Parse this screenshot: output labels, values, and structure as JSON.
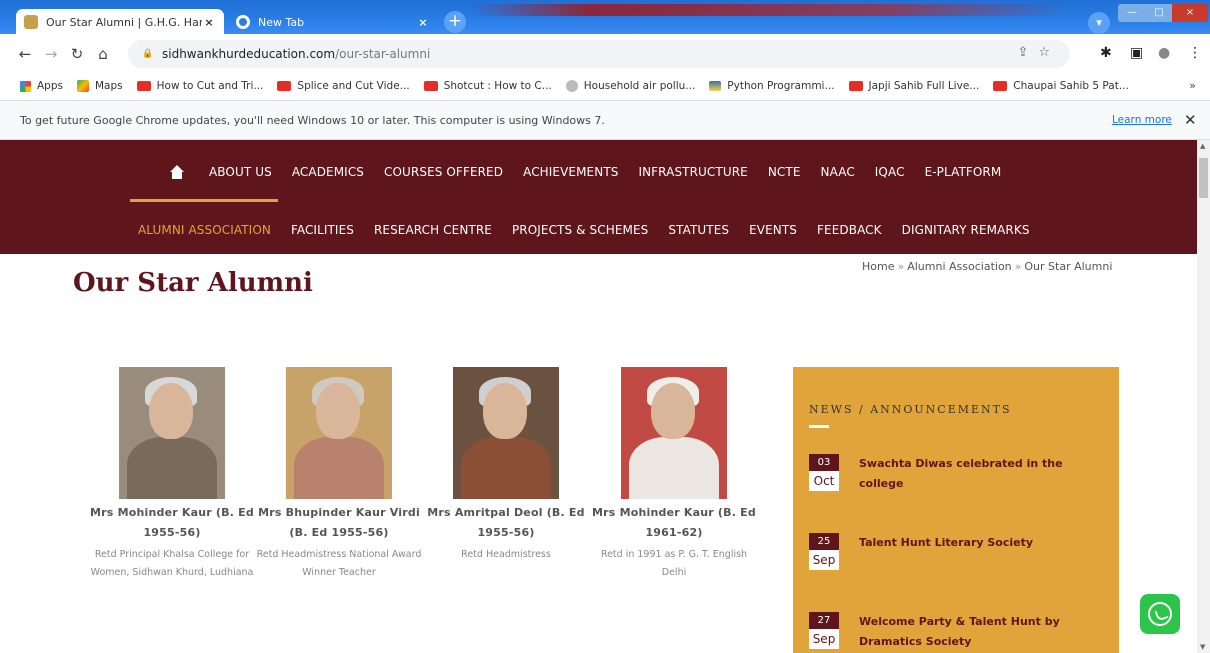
{
  "browser": {
    "tabs": [
      {
        "title": "Our Star Alumni | G.H.G. Harpark",
        "close": "×"
      },
      {
        "title": "New Tab",
        "close": "×"
      }
    ],
    "new_tab": "+",
    "window_controls": {
      "minimize": "—",
      "maximize": "□",
      "close": "×"
    },
    "url_host": "sidhwankhurdeducation.com",
    "url_path": "/our-star-alumni",
    "bookmarks": [
      {
        "label": "Apps",
        "icon": "apps-grid-icon"
      },
      {
        "label": "Maps",
        "icon": "maps-icon"
      },
      {
        "label": "How to Cut and Tri...",
        "icon": "youtube-icon"
      },
      {
        "label": "Splice and Cut Vide...",
        "icon": "youtube-icon"
      },
      {
        "label": "Shotcut : How to C...",
        "icon": "youtube-icon"
      },
      {
        "label": "Household air pollu...",
        "icon": "wikipedia-icon"
      },
      {
        "label": "Python Programmi...",
        "icon": "python-icon"
      },
      {
        "label": "Japji Sahib Full Live...",
        "icon": "youtube-icon"
      },
      {
        "label": "Chaupai Sahib 5 Pat...",
        "icon": "youtube-icon"
      }
    ],
    "bookmarks_more": "»",
    "infobar": {
      "message": "To get future Google Chrome updates, you'll need Windows 10 or later. This computer is using Windows 7.",
      "learn_more": "Learn more",
      "close": "✕"
    }
  },
  "nav": {
    "row1": [
      "ABOUT US",
      "ACADEMICS",
      "COURSES OFFERED",
      "ACHIEVEMENTS",
      "INFRASTRUCTURE",
      "NCTE",
      "NAAC",
      "IQAC",
      "E-PLATFORM"
    ],
    "row2": [
      "ALUMNI ASSOCIATION",
      "FACILITIES",
      "RESEARCH CENTRE",
      "PROJECTS & SCHEMES",
      "STATUTES",
      "EVENTS",
      "FEEDBACK",
      "DIGNITARY REMARKS"
    ]
  },
  "page": {
    "title": "Our Star Alumni",
    "breadcrumb": [
      "Home",
      "Alumni Association",
      "Our Star Alumni"
    ],
    "breadcrumb_sep": "»"
  },
  "alumni": [
    {
      "name": "Mrs Mohinder Kaur (B. Ed 1955-56)",
      "desc": "Retd Principal Khalsa College for Women, Sidhwan Khurd, Ludhiana",
      "photo_bg": "#9a8c7c",
      "dress": "#7a6a5c"
    },
    {
      "name": "Mrs Bhupinder Kaur Virdi (B. Ed 1955-56)",
      "desc": "Retd Headmistress National Award Winner Teacher",
      "photo_bg": "#c7a36a",
      "dress": "#b8826c"
    },
    {
      "name": "Mrs Amritpal Deol (B. Ed 1955-56)",
      "desc": "Retd Headmistress",
      "photo_bg": "#6b5240",
      "dress": "#8a4f36"
    },
    {
      "name": "Mrs Mohinder Kaur (B. Ed 1961-62)",
      "desc": "Retd in 1991 as P. G. T. English Delhi",
      "photo_bg": "#c24a44",
      "dress": "#ece7e2"
    }
  ],
  "news": {
    "heading": "NEWS / ANNOUNCEMENTS",
    "items": [
      {
        "day": "03",
        "month": "Oct",
        "title": "Swachta Diwas celebrated in the college"
      },
      {
        "day": "25",
        "month": "Sep",
        "title": "Talent Hunt Literary Society"
      },
      {
        "day": "27",
        "month": "Sep",
        "title": "Welcome Party & Talent Hunt by Dramatics Society"
      }
    ]
  },
  "colors": {
    "brand": "#5e161c",
    "accent": "#e0a436",
    "news_bg": "#e0a43b"
  }
}
